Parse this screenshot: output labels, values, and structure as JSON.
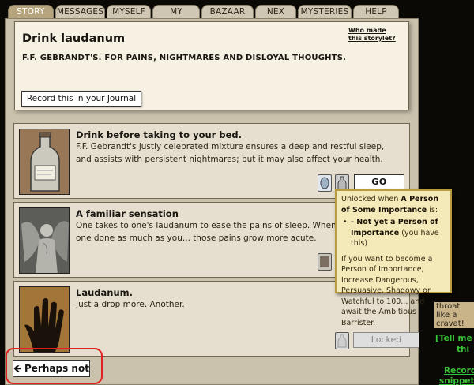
{
  "tabs": [
    "STORY",
    "MESSAGES",
    "MYSELF",
    "MY FRIENDS",
    "BAZAAR",
    "NEX",
    "MYSTERIES",
    "HELP"
  ],
  "storylet": {
    "title": "Drink laudanum",
    "description": "F.F. GEBRANDT'S. FOR PAINS, NIGHTMARES AND DISLOYAL THOUGHTS.",
    "who_made": "Who made this storylet?",
    "journal_button": "Record this in your Journal"
  },
  "branches": [
    {
      "title": "Drink before taking to your bed.",
      "text": "F.F. Gebrandt's justly celebrated mixture ensures a deep and restful sleep, and assists with persistent nightmares; but it may also affect your health.",
      "button": "GO"
    },
    {
      "title": "A familiar sensation",
      "text": "One takes to one's laudanum to ease the pains of sleep. When one done as much as you... those pains grow more acute."
    },
    {
      "title": "Laudanum.",
      "text": "Just a drop more. Another.",
      "button": "Locked"
    }
  ],
  "tooltip": {
    "intro": "Unlocked when",
    "quality": "A Person of Some Importance",
    "is": "is:",
    "requirement": "- Not yet a Person of Importance",
    "have": "(you have this)",
    "advice": "If you want to become a Person of Importance, Increase Dangerous, Persuasive, Shadowy or Watchful to 100... and await the Ambitious Barrister."
  },
  "perhaps_not": "Perhaps not",
  "sidebar": {
    "partial_1": "throat like a",
    "partial_2": "cravat!",
    "tell_me": "[Tell me",
    "thi": "thi",
    "record": "Record",
    "snippet": "snippet"
  },
  "colors": {
    "tooltip_bg": "#f4e9b8",
    "highlight": "#e32121",
    "link_green": "#38c438"
  }
}
